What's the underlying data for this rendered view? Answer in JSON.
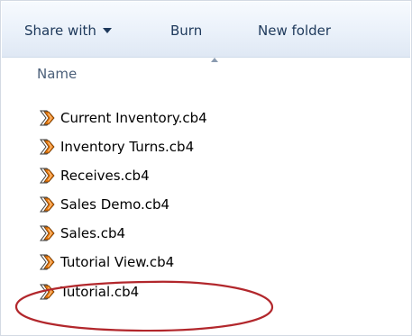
{
  "toolbar": {
    "share_label": "Share with",
    "burn_label": "Burn",
    "new_folder_label": "New folder"
  },
  "columns": {
    "name_header": "Name"
  },
  "files": [
    {
      "name": "Current Inventory.cb4",
      "icon": "cb4-file-icon"
    },
    {
      "name": "Inventory Turns.cb4",
      "icon": "cb4-file-icon"
    },
    {
      "name": "Receives.cb4",
      "icon": "cb4-file-icon"
    },
    {
      "name": "Sales Demo.cb4",
      "icon": "cb4-file-icon"
    },
    {
      "name": "Sales.cb4",
      "icon": "cb4-file-icon"
    },
    {
      "name": "Tutorial View.cb4",
      "icon": "cb4-file-icon"
    },
    {
      "name": "Tutorial.cb4",
      "icon": "cb4-file-icon",
      "highlighted": true
    }
  ],
  "colors": {
    "toolbar_text": "#1e395b",
    "highlight_ellipse": "#b2272c",
    "icon_orange": "#e8790f"
  }
}
